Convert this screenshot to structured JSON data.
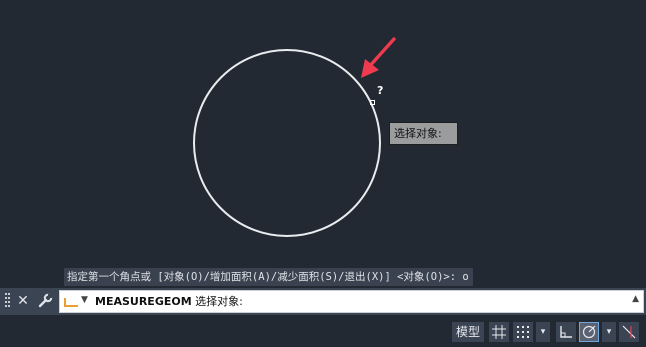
{
  "canvas": {
    "tooltip_text": "选择对象:",
    "cursor_hint": "?",
    "history_line": "指定第一个角点或 [对象(O)/增加面积(A)/减少面积(S)/退出(X)] <对象(O)>: o",
    "colors": {
      "background": "#222933",
      "circle": "#e9ecee",
      "arrow": "#ef3b4f"
    }
  },
  "command_bar": {
    "close_icon": "close-icon",
    "customize_icon": "wrench-icon",
    "command_name": "MEASUREGEOM",
    "prompt": " 选择对象:",
    "dropdown_icon": "chevron-down-icon",
    "history_icon": "chevron-up-icon"
  },
  "status_bar": {
    "model_label": "模型",
    "grid_icon": "grid-icon",
    "snap_icon": "snap-dots-icon",
    "ortho_icon": "ortho-icon",
    "polar_icon": "polar-tracking-icon",
    "osnap_icon": "object-snap-icon",
    "dropdown_glyph": "▾"
  }
}
